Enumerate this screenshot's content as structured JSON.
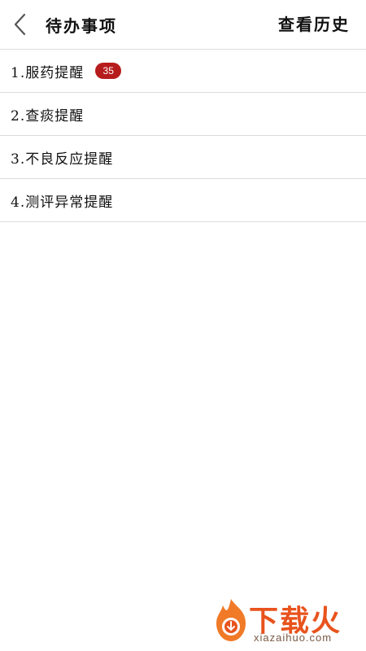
{
  "header": {
    "title": "待办事项",
    "history_label": "查看历史",
    "back_icon": "chevron-left-icon"
  },
  "list": {
    "items": [
      {
        "label": "1.服药提醒",
        "badge": "35"
      },
      {
        "label": "2.查痰提醒"
      },
      {
        "label": "3.不良反应提醒"
      },
      {
        "label": "4.测评异常提醒"
      }
    ]
  },
  "colors": {
    "badge": "#b71c1c",
    "divider": "#dcdcdc",
    "watermark": "#e8531d"
  },
  "watermark": {
    "name": "下载火",
    "url": "xiazaihuo.com"
  }
}
